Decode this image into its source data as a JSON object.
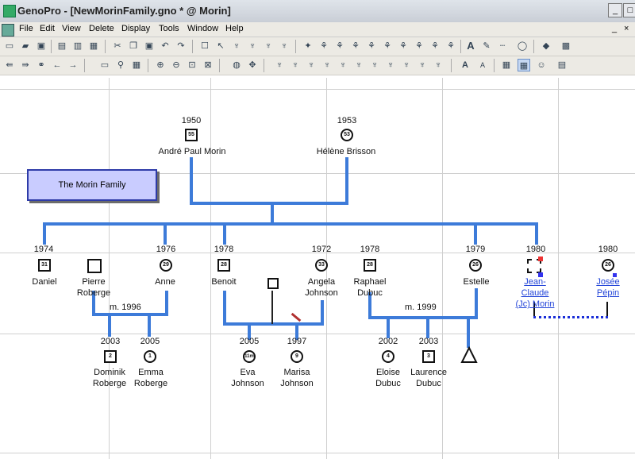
{
  "window": {
    "title": "GenoPro - [NewMorinFamily.gno * @ Morin]"
  },
  "menu": [
    "File",
    "Edit",
    "View",
    "Delete",
    "Display",
    "Tools",
    "Window",
    "Help"
  ],
  "family_label": "The Morin Family",
  "people": {
    "andre": {
      "year": "1950",
      "name": "André Paul Morin",
      "age": "55"
    },
    "helene": {
      "year": "1953",
      "name": "Hélène Brisson",
      "age": "53"
    },
    "daniel": {
      "year": "1974",
      "name": "Daniel",
      "age": "31"
    },
    "pierre": {
      "year": "",
      "name": "Pierre\nRoberge",
      "age": ""
    },
    "anne": {
      "year": "1976",
      "name": "Anne",
      "age": "29"
    },
    "benoit": {
      "year": "1978",
      "name": "Benoit",
      "age": "28"
    },
    "angela": {
      "year": "1972",
      "name": "Angela\nJohnson",
      "age": "33"
    },
    "raphael": {
      "year": "1978",
      "name": "Raphael\nDubuc",
      "age": "28"
    },
    "estelle": {
      "year": "1979",
      "name": "Estelle",
      "age": "26"
    },
    "jc": {
      "year": "1980",
      "name": "Jean-\nClaude\n(Jc) Morin",
      "age": ""
    },
    "josee": {
      "year": "1980",
      "name": "Josée\nPépin",
      "age": "26"
    },
    "dominik": {
      "year": "2003",
      "name": "Dominik\nRoberge",
      "age": "2"
    },
    "emma": {
      "year": "2005",
      "name": "Emma\nRoberge",
      "age": "1"
    },
    "eva": {
      "year": "2005",
      "name": "Eva\nJohnson",
      "age": "11m"
    },
    "marisa": {
      "year": "1997",
      "name": "Marisa\nJohnson",
      "age": "9"
    },
    "eloise": {
      "year": "2002",
      "name": "Eloise\nDubuc",
      "age": "4"
    },
    "laurence": {
      "year": "2003",
      "name": "Laurence\nDubuc",
      "age": "3"
    }
  },
  "marriages": {
    "anne_pierre": "m. 1996",
    "estelle_raphael": "m. 1999"
  }
}
